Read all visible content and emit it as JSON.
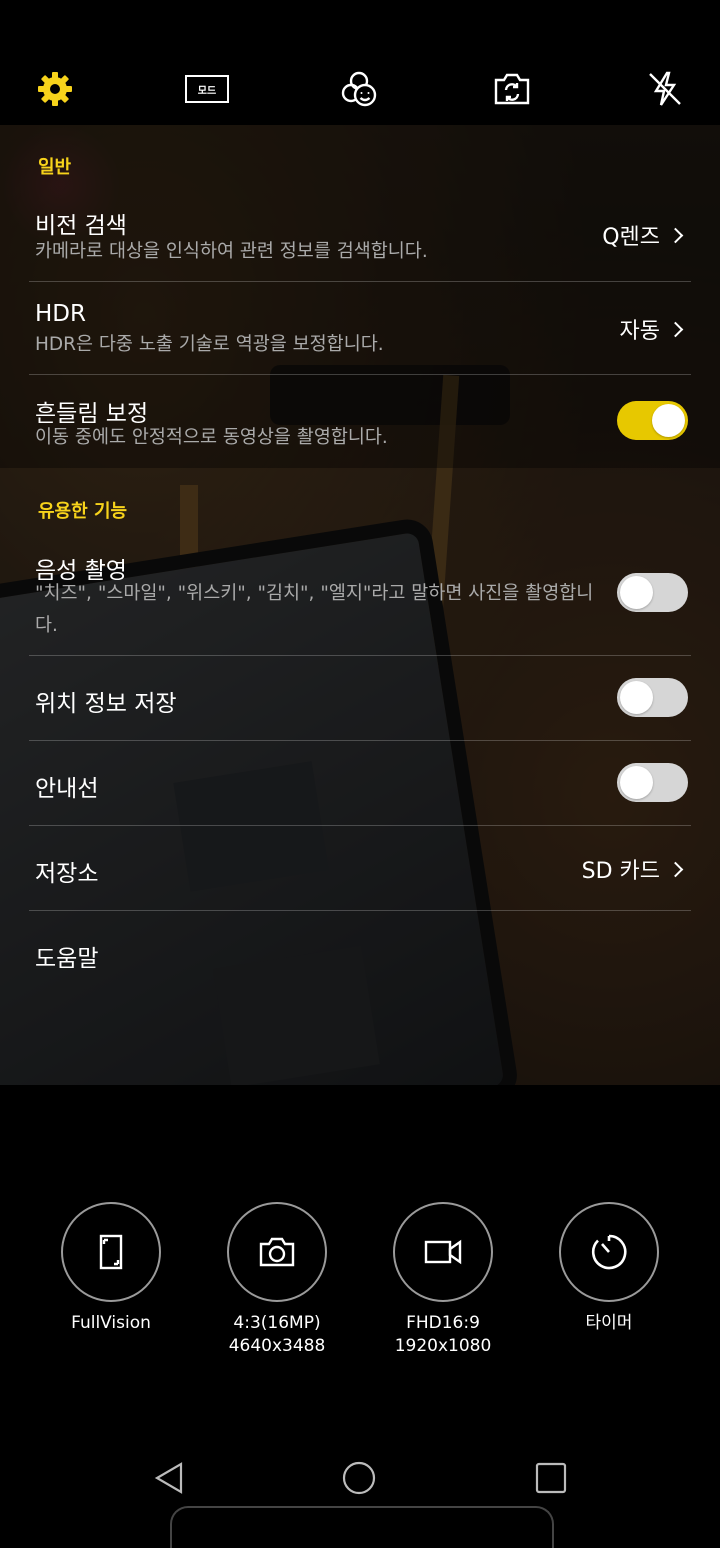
{
  "topbar": {
    "icons": [
      "gear-icon",
      "mode-icon",
      "face-filter-icon",
      "switch-camera-icon",
      "flash-off-icon"
    ],
    "mode_label": "모드",
    "accent": "#f7d31b"
  },
  "sections": {
    "general": "일반",
    "useful": "유용한 기능"
  },
  "settings": {
    "vision_search": {
      "title": "비전 검색",
      "desc": "카메라로 대상을 인식하여 관련 정보를 검색합니다.",
      "value": "Q렌즈"
    },
    "hdr": {
      "title": "HDR",
      "desc": "HDR은 다중 노출 기술로 역광을 보정합니다.",
      "value": "자동"
    },
    "stabilization": {
      "title": "흔들림 보정",
      "desc": "이동 중에도 안정적으로 동영상을 촬영합니다.",
      "enabled": true
    },
    "voice_shutter": {
      "title": "음성 촬영",
      "desc": "\"치즈\", \"스마일\", \"위스키\", \"김치\", \"엘지\"라고 말하면 사진을 촬영합니다.",
      "enabled": false
    },
    "location": {
      "title": "위치 정보 저장",
      "enabled": false
    },
    "guide_lines": {
      "title": "안내선",
      "enabled": false
    },
    "storage": {
      "title": "저장소",
      "value": "SD 카드"
    },
    "help": {
      "title": "도움말"
    }
  },
  "quick_settings": [
    {
      "icon": "full-vision-icon",
      "line1": "FullVision",
      "line2": ""
    },
    {
      "icon": "photo-size-icon",
      "line1": "4:3(16MP)",
      "line2": "4640x3488"
    },
    {
      "icon": "video-size-icon",
      "line1": "FHD16:9",
      "line2": "1920x1080"
    },
    {
      "icon": "timer-icon",
      "line1": "타이머",
      "line2": ""
    }
  ],
  "navbar": [
    "back-icon",
    "home-icon",
    "recents-icon"
  ]
}
